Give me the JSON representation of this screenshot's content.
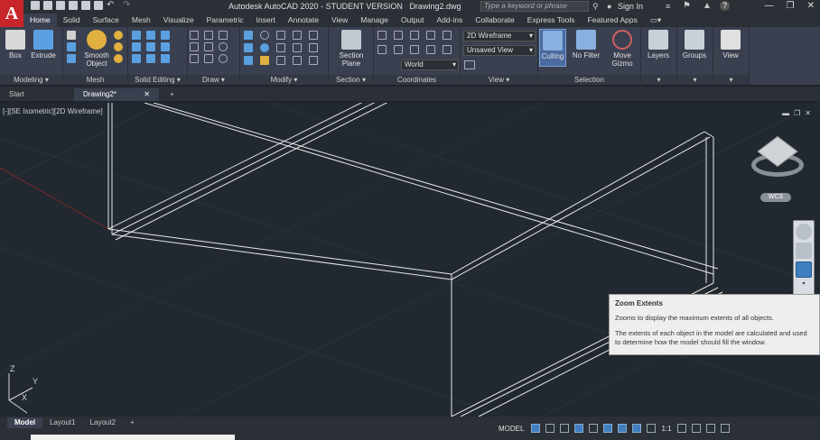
{
  "app": {
    "logo_letter": "A",
    "title": "Autodesk AutoCAD 2020 - STUDENT VERSION",
    "filename": "Drawing2.dwg",
    "search_placeholder": "Type a keyword or phrase",
    "sign_in": "Sign In",
    "help": "?"
  },
  "ribbon_tabs": [
    "Home",
    "Solid",
    "Surface",
    "Mesh",
    "Visualize",
    "Parametric",
    "Insert",
    "Annotate",
    "View",
    "Manage",
    "Output",
    "Add-ins",
    "Collaborate",
    "Express Tools",
    "Featured Apps"
  ],
  "ribbon": {
    "buttons": {
      "box": "Box",
      "extrude": "Extrude",
      "smooth_object": "Smooth Object",
      "section_plane": "Section Plane",
      "culling": "Culling",
      "no_filter": "No Filter",
      "move_gizmo": "Move Gizmo",
      "layers": "Layers",
      "groups": "Groups",
      "view": "View"
    },
    "panels": {
      "modeling": "Modeling",
      "mesh": "Mesh",
      "solid_editing": "Solid Editing",
      "draw": "Draw",
      "modify": "Modify",
      "section": "Section",
      "coordinates": "Coordinates",
      "view": "View",
      "selection": "Selection"
    },
    "visual_style": "2D Wireframe",
    "saved_view": "Unsaved View",
    "ucs": "World"
  },
  "file_tabs": [
    "Start",
    "Drawing2*"
  ],
  "viewport": {
    "label": "[-][SE Isometric][2D Wireframe]",
    "wcs": "WCS",
    "axis_x": "X",
    "axis_y": "Y",
    "axis_z": "Z"
  },
  "tooltip": {
    "title": "Zoom Extents",
    "line1": "Zooms to display the maximum extents of all objects.",
    "line2": "The extents of each object in the model are calculated and used to determine how the model should fill the window."
  },
  "layout_tabs": [
    "Model",
    "Layout1",
    "Layout2"
  ],
  "status": {
    "model": "MODEL",
    "scale": "1:1"
  },
  "colors": {
    "background": "#212830",
    "ribbon": "#3a4050",
    "accent": "#3f7fc0",
    "logo": "#c8262a"
  }
}
